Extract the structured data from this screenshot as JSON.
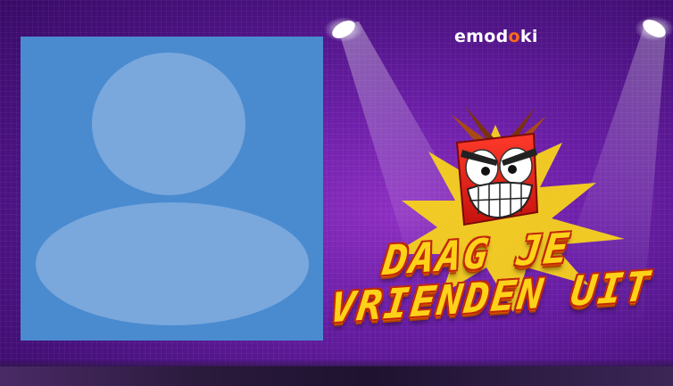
{
  "brand": {
    "logo_text_part1": "emod",
    "logo_text_part2": "o",
    "logo_text_part3": "ki"
  },
  "headline": {
    "line1": "DAAG JE",
    "line2": "VRIENDEN UIT"
  },
  "avatar": {
    "icon": "user-silhouette-icon"
  },
  "mascot": {
    "icon": "angry-red-square-mascot-icon"
  },
  "colors": {
    "background": "#6a1ea6",
    "avatar_bg": "#4a8bd0",
    "avatar_fg": "#7aa8dc",
    "headline_fill": "#ffd21a",
    "headline_outline": "#c0280a",
    "mascot_red": "#e8231c",
    "burst_yellow": "#f7d21e",
    "logo_accent": "#ff6a1a"
  }
}
